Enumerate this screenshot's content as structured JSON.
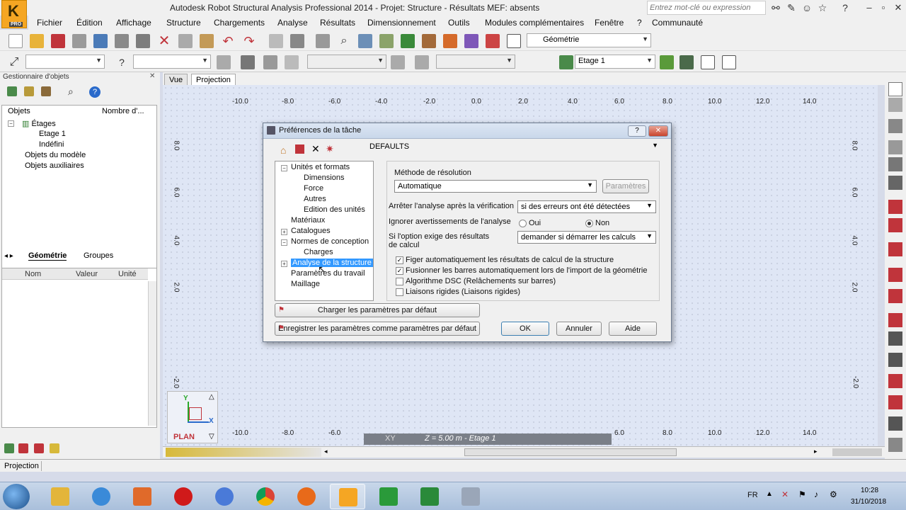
{
  "window": {
    "title": "Autodesk Robot Structural Analysis Professional 2014 - Projet: Structure - Résultats MEF: absents",
    "search_placeholder": "Entrez mot-clé ou expression",
    "logo_letter": "K",
    "logo_badge": "PRO"
  },
  "menu": [
    "Fichier",
    "Édition",
    "Affichage",
    "Structure",
    "Chargements",
    "Analyse",
    "Résultats",
    "Dimensionnement",
    "Outils",
    "Modules complémentaires",
    "Fenêtre",
    "?",
    "Communauté"
  ],
  "toolbar": {
    "view_combo": "Géométrie",
    "level_combo": "Etage 1"
  },
  "object_manager": {
    "title": "Gestionnaire d'objets",
    "col_objects": "Objets",
    "col_count": "Nombre d'...",
    "tree": [
      {
        "label": "Étages",
        "depth": 0
      },
      {
        "label": "Etage 1",
        "depth": 1
      },
      {
        "label": "Indéfini",
        "depth": 1
      },
      {
        "label": "Objets du modèle",
        "depth": 0
      },
      {
        "label": "Objets auxiliaires",
        "depth": 0
      }
    ],
    "tabs": [
      "Géométrie",
      "Groupes"
    ],
    "props_cols": [
      "Nom",
      "Valeur",
      "Unité"
    ]
  },
  "view": {
    "tabs": [
      "Vue",
      "Projection"
    ],
    "x_ticks": [
      "-10.0",
      "-8.0",
      "-6.0",
      "-4.0",
      "-2.0",
      "0.0",
      "2.0",
      "4.0",
      "6.0",
      "8.0",
      "10.0",
      "12.0",
      "14.0"
    ],
    "y_ticks": [
      "8.0",
      "6.0",
      "4.0",
      "2.0",
      "-2.0"
    ],
    "plan_label": "PLAN",
    "axis_x": "X",
    "axis_y": "Y",
    "bottom_info_left": "XY",
    "bottom_info": "Z = 5.00 m - Etage 1"
  },
  "status_bar": {
    "text": "Projection"
  },
  "dialog": {
    "title": "Préférences de la tâche",
    "help_btn": "?",
    "close_btn": "✕",
    "preset": "DEFAULTS",
    "tree": [
      {
        "label": "Unités et formats",
        "depth": 0,
        "expander": "−"
      },
      {
        "label": "Dimensions",
        "depth": 1
      },
      {
        "label": "Force",
        "depth": 1
      },
      {
        "label": "Autres",
        "depth": 1
      },
      {
        "label": "Edition des unités",
        "depth": 1
      },
      {
        "label": "Matériaux",
        "depth": 0
      },
      {
        "label": "Catalogues",
        "depth": 0,
        "expander": "+"
      },
      {
        "label": "Normes de conception",
        "depth": 0,
        "expander": "−"
      },
      {
        "label": "Charges",
        "depth": 1
      },
      {
        "label": "Analyse de la structure",
        "depth": 0,
        "expander": "+",
        "selected": true
      },
      {
        "label": "Paramètres du travail",
        "depth": 0
      },
      {
        "label": "Maillage",
        "depth": 0
      }
    ],
    "method_label": "Méthode de résolution",
    "method_value": "Automatique",
    "params_btn": "Paramètres",
    "stop_label": "Arrêter l'analyse après la vérification",
    "stop_value": "si des erreurs ont été détectées",
    "ignore_label": "Ignorer avertissements de l'analyse",
    "radio_yes": "Oui",
    "radio_no": "Non",
    "option_label_1": "Si l'option exige des résultats",
    "option_label_2": "de calcul",
    "option_value": "demander si démarrer les calculs",
    "checkboxes": [
      {
        "label": "Figer automatiquement les résultats de calcul de la structure",
        "checked": true
      },
      {
        "label": "Fusionner les barres automatiquement lors de l'import de la géométrie",
        "checked": true
      },
      {
        "label": "Algorithme DSC (Relâchements sur barres)",
        "checked": false
      },
      {
        "label": "Liaisons rigides (Liaisons rigides)",
        "checked": false
      }
    ],
    "load_defaults_btn": "Charger les paramètres par défaut",
    "save_defaults_btn": "Enregistrer les paramètres comme paramètres par défaut",
    "ok_btn": "OK",
    "cancel_btn": "Annuler",
    "help_text_btn": "Aide"
  },
  "taskbar": {
    "lang": "FR",
    "time": "10:28",
    "date": "31/10/2018"
  },
  "colors": {
    "selection": "#3399ff",
    "dialog_title": "#c9d7ea",
    "close_btn": "#c9452e",
    "robot_logo": "#f5a623"
  }
}
